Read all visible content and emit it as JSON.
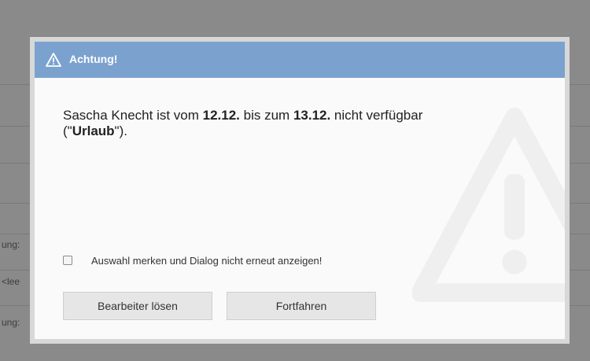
{
  "background": {
    "fragments": [
      "ung:",
      "<lee",
      "ung:"
    ]
  },
  "dialog": {
    "title": "Achtung!",
    "title_icon": "warning-triangle-icon",
    "watermark_icon": "warning-triangle-icon",
    "message": {
      "prefix": "Sascha Knecht ist vom ",
      "from_date": "12.12.",
      "middle": " bis zum ",
      "to_date": "13.12.",
      "suffix": " nicht verfügbar",
      "reason_open": "(\"",
      "reason": "Urlaub",
      "reason_close": "\")."
    },
    "checkbox": {
      "label": "Auswahl merken und Dialog nicht erneut anzeigen!",
      "checked": false
    },
    "buttons": {
      "release_label": "Bearbeiter lösen",
      "continue_label": "Fortfahren"
    }
  },
  "colors": {
    "titlebar": "#7ba2cf",
    "overlay": "#8a8a8a",
    "dialog_body": "#fafafa"
  }
}
